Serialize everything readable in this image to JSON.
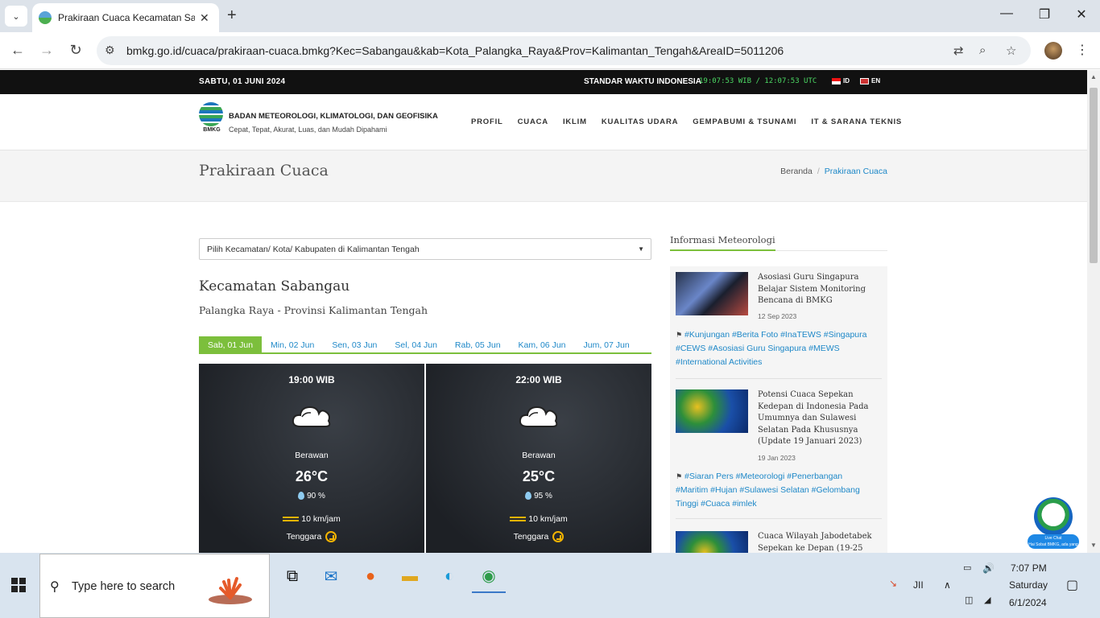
{
  "browser": {
    "tab_title": "Prakiraan Cuaca Kecamatan Sabangau",
    "url": "bmkg.go.id/cuaca/prakiraan-cuaca.bmkg?Kec=Sabangau&kab=Kota_Palangka_Raya&Prov=Kalimantan_Tengah&AreaID=5011206"
  },
  "topbar": {
    "date": "SABTU, 01 JUNI 2024",
    "time_label": "STANDAR WAKTU INDONESIA",
    "clock": "19:07:53 WIB / 12:07:53 UTC",
    "lang_id": "ID",
    "lang_en": "EN"
  },
  "header": {
    "logo_text": "BMKG",
    "org_name": "BADAN METEOROLOGI, KLIMATOLOGI, DAN GEOFISIKA",
    "tagline": "Cepat, Tepat, Akurat, Luas, dan Mudah Dipahami",
    "nav": [
      "PROFIL",
      "CUACA",
      "IKLIM",
      "KUALITAS UDARA",
      "GEMPABUMI & TSUNAMI",
      "IT & SARANA TEKNIS"
    ]
  },
  "page": {
    "title": "Prakiraan Cuaca",
    "breadcrumb": [
      "Beranda",
      "Prakiraan Cuaca"
    ],
    "select_label": "Pilih Kecamatan/ Kota/ Kabupaten di Kalimantan Tengah",
    "kecamatan": "Kecamatan Sabangau",
    "subtitle": "Palangka Raya - Provinsi Kalimantan Tengah",
    "day_tabs": [
      "Sab, 01 Jun",
      "Min, 02 Jun",
      "Sen, 03 Jun",
      "Sel, 04 Jun",
      "Rab, 05 Jun",
      "Kam, 06 Jun",
      "Jum, 07 Jun"
    ]
  },
  "forecast": [
    {
      "time": "19:00 WIB",
      "condition": "Berawan",
      "temp": "26°C",
      "humidity": "90 %",
      "wind": "10 km/jam",
      "direction": "Tenggara"
    },
    {
      "time": "22:00 WIB",
      "condition": "Berawan",
      "temp": "25°C",
      "humidity": "95 %",
      "wind": "10 km/jam",
      "direction": "Tenggara"
    }
  ],
  "sidebar": {
    "title": "Informasi Meteorologi",
    "news": [
      {
        "title": "Asosiasi Guru Singapura Belajar Sistem Monitoring Bencana di BMKG",
        "date": "12 Sep 2023",
        "tags": "#Kunjungan #Berita Foto #InaTEWS #Singapura #CEWS #Asosiasi Guru Singapura #MEWS #International Activities"
      },
      {
        "title": "Potensi Cuaca Sepekan Kedepan di Indonesia Pada Umumnya dan Sulawesi Selatan Pada Khususnya (Update 19 Januari 2023)",
        "date": "19 Jan 2023",
        "tags": "#Siaran Pers #Meteorologi #Penerbangan #Maritim #Hujan #Sulawesi Selatan #Gelombang Tinggi #Cuaca #imlek"
      },
      {
        "title": "Cuaca Wilayah Jabodetabek Sepekan ke Depan (19-25",
        "date": "",
        "tags": ""
      }
    ]
  },
  "livechat": {
    "label": "Live Chat",
    "sub": "Hai Sobat BMKG, ada yang bisa kami bantu?"
  },
  "taskbar": {
    "search_placeholder": "Type here to search",
    "weather_text": "JII",
    "time": "7:07 PM",
    "day": "Saturday",
    "date": "6/1/2024"
  }
}
